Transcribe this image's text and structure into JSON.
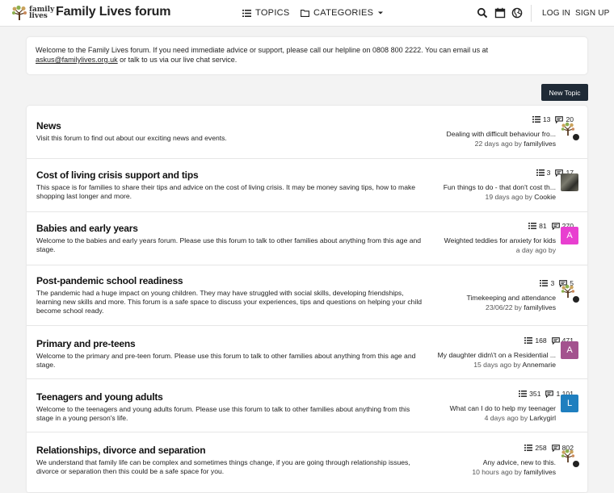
{
  "header": {
    "logo_text_1": "family",
    "logo_text_2": "lives",
    "site_title": "Family Lives forum",
    "nav_topics": "TOPICS",
    "nav_categories": "CATEGORIES",
    "login": "LOG IN",
    "signup": "SIGN UP"
  },
  "notice": {
    "text_1": "Welcome to the Family Lives forum. If you need immediate advice or support, please call our helpline on 0808 800 2222. You can email us at",
    "email": "askus@familylives.org.uk",
    "text_2": " or talk to us via our live chat service."
  },
  "new_topic_label": "New Topic",
  "categories": [
    {
      "title": "News",
      "description": "Visit this forum to find out about our exciting news and events.",
      "topics": "13",
      "posts": "20",
      "latest_title": "Dealing with difficult behaviour fro...",
      "latest_time": "22 days ago",
      "latest_by": "by",
      "latest_user": "familylives",
      "avatar_type": "logo"
    },
    {
      "title": "Cost of living crisis support and tips",
      "description": "This space is for families to share their tips and advice on the cost of living crisis. It may be money saving tips, how to make shopping last longer and more.",
      "topics": "3",
      "posts": "17",
      "latest_title": "Fun things to do - that don't cost th...",
      "latest_time": "19 days ago",
      "latest_by": "by",
      "latest_user": "Cookie",
      "avatar_type": "photo"
    },
    {
      "title": "Babies and early years",
      "description": "Welcome to the babies and early years forum. Please use this forum to talk to other families about anything from this age and stage.",
      "topics": "81",
      "posts": "270",
      "latest_title": "Weighted teddies for anxiety for kids",
      "latest_time": "a day ago",
      "latest_by": "by",
      "latest_user": "",
      "avatar_type": "letter",
      "avatar_letter": "A",
      "avatar_color": "#e83fd0"
    },
    {
      "title": "Post-pandemic school readiness",
      "description": "The pandemic had a huge impact on young children. They may have struggled with social skills, developing friendships, learning new skills and more. This forum is a safe space to discuss your experiences, tips and questions on helping your child become school ready.",
      "topics": "3",
      "posts": "5",
      "latest_title": "Timekeeping and attendance",
      "latest_time": "23/06/22",
      "latest_by": "by",
      "latest_user": "familylives",
      "avatar_type": "logo"
    },
    {
      "title": "Primary and pre-teens",
      "description": "Welcome to the primary and pre-teen forum. Please use this forum to talk to other families about anything from this age and stage.",
      "topics": "168",
      "posts": "471",
      "latest_title": "My daughter didn\\'t on a Residential ...",
      "latest_time": "15 days ago",
      "latest_by": "by",
      "latest_user": "Annemarie",
      "avatar_type": "letter",
      "avatar_letter": "A",
      "avatar_color": "#a3528e"
    },
    {
      "title": "Teenagers and young adults",
      "description": "Welcome to the teenagers and young adults forum. Please use this forum to talk to other families about anything from this stage in a young person's life.",
      "topics": "351",
      "posts": "1,101",
      "latest_title": "What can I do to help my teenager",
      "latest_time": "4 days ago",
      "latest_by": "by",
      "latest_user": "Larkygirl",
      "avatar_type": "letter",
      "avatar_letter": "L",
      "avatar_color": "#1f7fbf"
    },
    {
      "title": "Relationships, divorce and separation",
      "description": "We understand that family life can be complex and sometimes things change, if you are going through relationship issues, divorce or separation then this could be a safe space for you.",
      "topics": "258",
      "posts": "802",
      "latest_title": "Any advice, new to this.",
      "latest_time": "10 hours ago",
      "latest_by": "by",
      "latest_user": "familylives",
      "avatar_type": "logo"
    }
  ]
}
